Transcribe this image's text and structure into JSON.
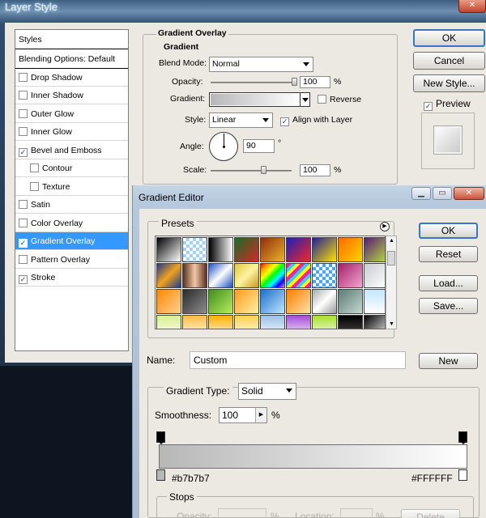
{
  "layer_style": {
    "title": "Layer Style",
    "close_glyph": "✕",
    "styles_list": [
      {
        "label": "Styles",
        "type": "head"
      },
      {
        "label": "Blending Options: Default",
        "type": "head"
      },
      {
        "label": "Drop Shadow",
        "checked": false
      },
      {
        "label": "Inner Shadow",
        "checked": false
      },
      {
        "label": "Outer Glow",
        "checked": false
      },
      {
        "label": "Inner Glow",
        "checked": false
      },
      {
        "label": "Bevel and Emboss",
        "checked": true
      },
      {
        "label": "Contour",
        "checked": false,
        "indent": true
      },
      {
        "label": "Texture",
        "checked": false,
        "indent": true
      },
      {
        "label": "Satin",
        "checked": false
      },
      {
        "label": "Color Overlay",
        "checked": false
      },
      {
        "label": "Gradient Overlay",
        "checked": true,
        "selected": true
      },
      {
        "label": "Pattern Overlay",
        "checked": false
      },
      {
        "label": "Stroke",
        "checked": true
      }
    ],
    "panel": {
      "section_title": "Gradient Overlay",
      "group_title": "Gradient",
      "blend_mode_label": "Blend Mode:",
      "blend_mode_value": "Normal",
      "opacity_label": "Opacity:",
      "opacity_value": "100",
      "opacity_unit": "%",
      "opacity_level": 1.0,
      "gradient_label": "Gradient:",
      "reverse_label": "Reverse",
      "reverse_checked": false,
      "style_label": "Style:",
      "style_value": "Linear",
      "align_label": "Align with Layer",
      "align_checked": true,
      "angle_label": "Angle:",
      "angle_value": "90",
      "angle_unit": "°",
      "scale_label": "Scale:",
      "scale_value": "100",
      "scale_unit": "%",
      "scale_level": 0.67
    },
    "buttons": {
      "ok": "OK",
      "cancel": "Cancel",
      "new_style": "New Style...",
      "preview_label": "Preview",
      "preview_checked": true
    }
  },
  "gradient_editor": {
    "title": "Gradient Editor",
    "presets_label": "Presets",
    "buttons": {
      "ok": "OK",
      "reset": "Reset",
      "load": "Load...",
      "save": "Save...",
      "new": "New"
    },
    "name_label": "Name:",
    "name_value": "Custom",
    "gradient_type_label": "Gradient Type:",
    "gradient_type_value": "Solid",
    "smoothness_label": "Smoothness:",
    "smoothness_value": "100",
    "smoothness_unit": "%",
    "stop_left_color": "#b7b7b7",
    "stop_right_color": "#FFFFFF",
    "stops_label": "Stops",
    "stops_opacity_label": "Opacity:",
    "stops_location_label": "Location:",
    "stops_delete_label": "Delete",
    "stops_unit": "%"
  }
}
